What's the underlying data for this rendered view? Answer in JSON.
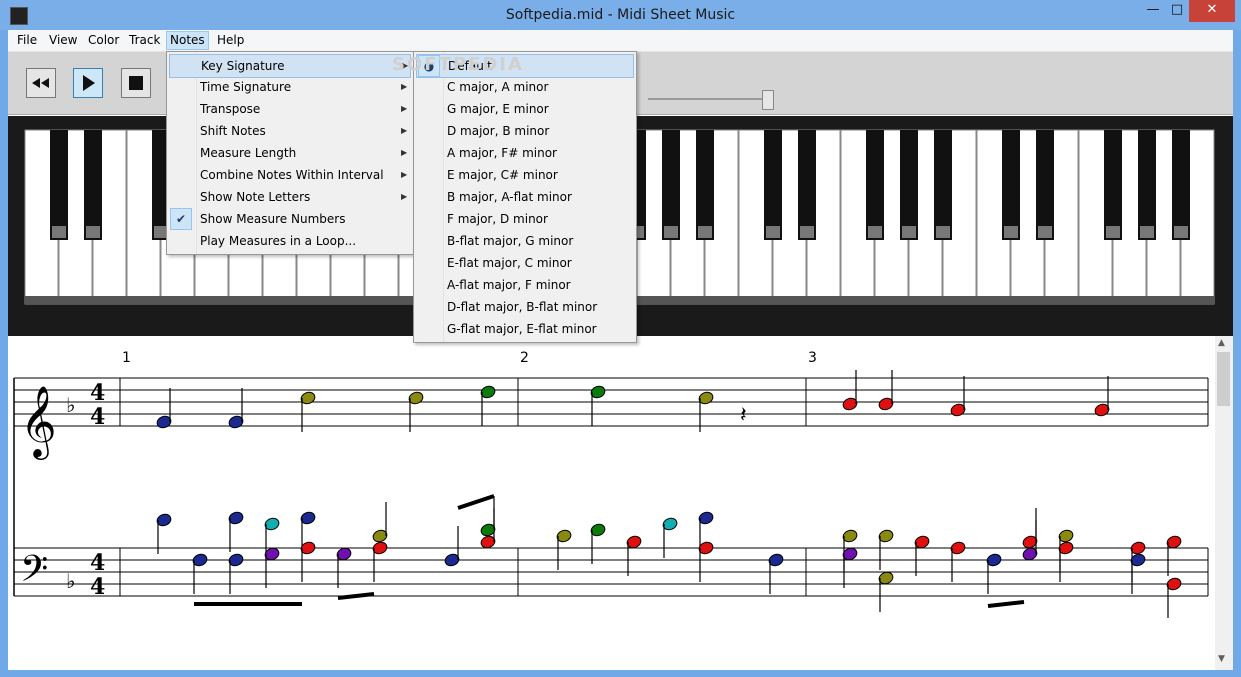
{
  "window": {
    "title": "Softpedia.mid - Midi Sheet Music",
    "controls": {
      "minimize": "—",
      "maximize": "□",
      "close": "✕"
    }
  },
  "menubar": {
    "items": [
      "File",
      "View",
      "Color",
      "Track",
      "Notes",
      "Help"
    ],
    "active": "Notes"
  },
  "notes_menu": {
    "items": [
      {
        "label": "Key Signature",
        "submenu": true
      },
      {
        "label": "Time Signature",
        "submenu": true
      },
      {
        "label": "Transpose",
        "submenu": true
      },
      {
        "label": "Shift Notes",
        "submenu": true
      },
      {
        "label": "Measure Length",
        "submenu": true
      },
      {
        "label": "Combine Notes Within Interval",
        "submenu": true
      },
      {
        "label": "Show Note Letters",
        "submenu": true
      },
      {
        "label": "Show Measure Numbers",
        "checked": true
      },
      {
        "label": "Play Measures in a Loop..."
      }
    ]
  },
  "key_signature_menu": {
    "items": [
      "Default",
      "C major, A minor",
      "G major, E minor",
      "D major, B minor",
      "A major, F# minor",
      "E major, C# minor",
      "B major, A-flat minor",
      "F major, D minor",
      "B-flat major, G minor",
      "E-flat major, C minor",
      "A-flat major, F minor",
      "D-flat major, B-flat minor",
      "G-flat major, E-flat minor"
    ],
    "selected": "Default"
  },
  "toolbar": {
    "rewind_icon": "rewind-icon",
    "play_icon": "play-icon",
    "stop_icon": "stop-icon",
    "volume_level": 0.95
  },
  "watermark": "SOFTPEDIA",
  "sheet": {
    "measure_numbers": [
      "1",
      "2",
      "3"
    ],
    "time_signature": {
      "top": "4",
      "bottom": "4"
    },
    "clefs": [
      "treble",
      "bass"
    ],
    "key_flat": "♭"
  },
  "colors": {
    "navy": "#1a2a90",
    "olive": "#8a8a10",
    "green": "#0a7a0a",
    "red": "#e01010",
    "teal": "#10b0b0",
    "purple": "#7010b0",
    "accent": "#3c7fb1"
  }
}
